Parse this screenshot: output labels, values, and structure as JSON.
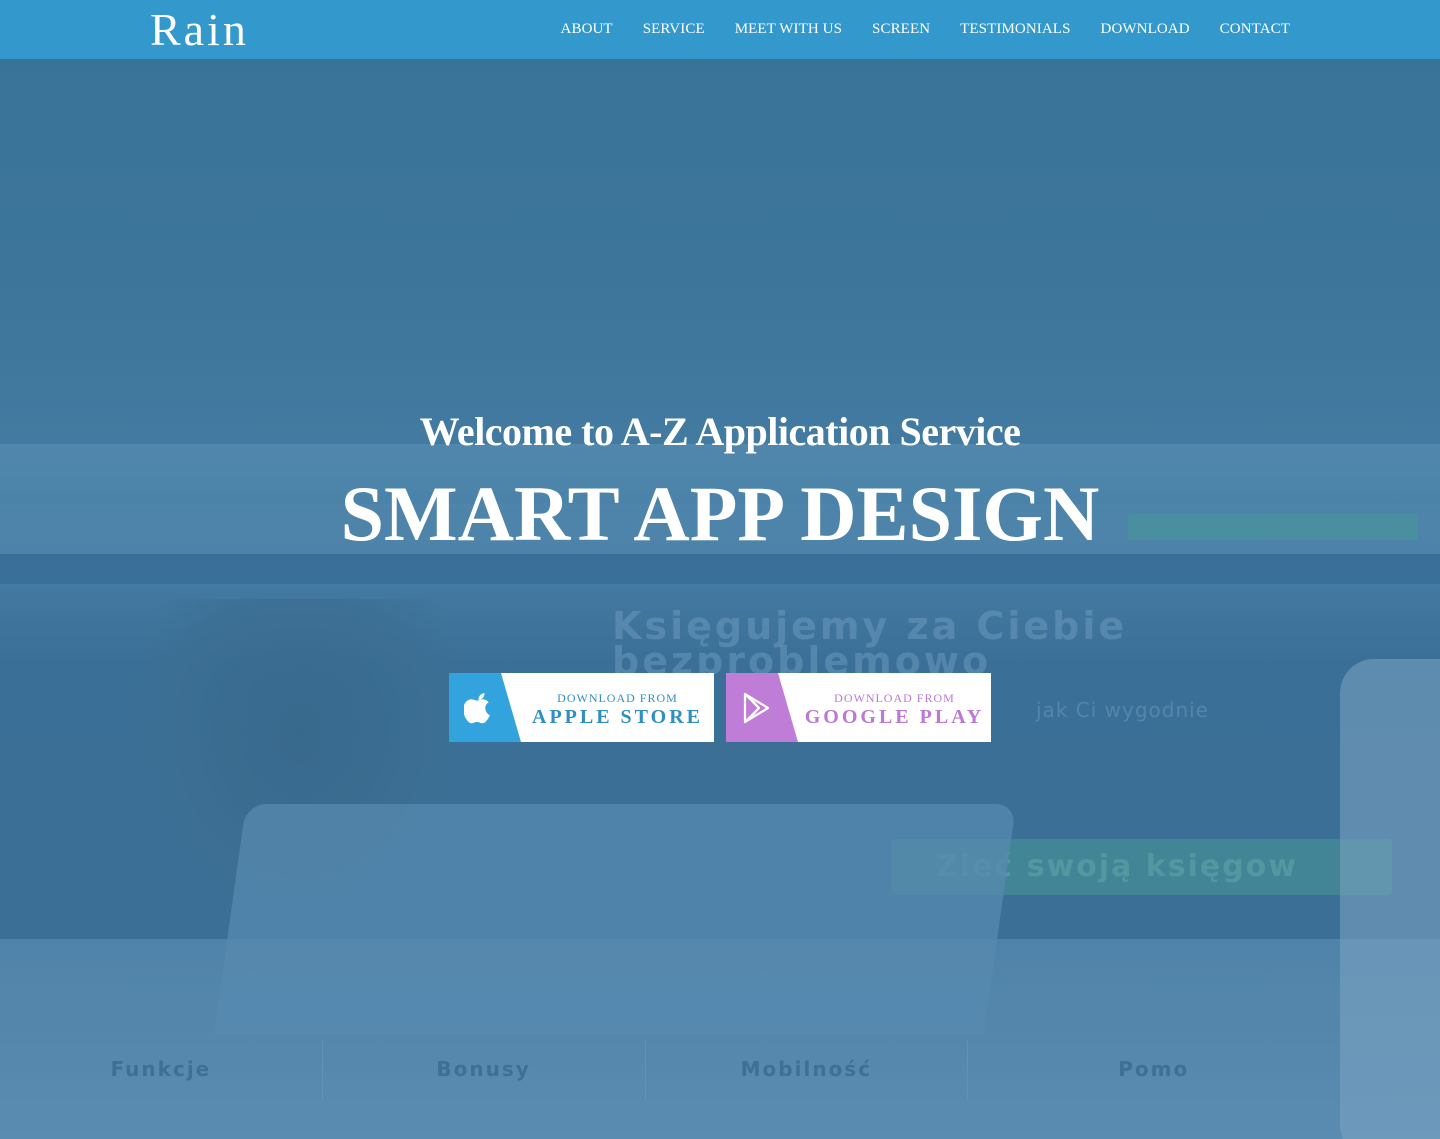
{
  "brand": {
    "logo": "Rain",
    "nav_color": "#3399cc"
  },
  "nav": {
    "items": [
      {
        "label": "ABOUT"
      },
      {
        "label": "SERVICE"
      },
      {
        "label": "MEET WITH US"
      },
      {
        "label": "SCREEN"
      },
      {
        "label": "TESTIMONIALS"
      },
      {
        "label": "DOWNLOAD"
      },
      {
        "label": "CONTACT"
      }
    ]
  },
  "hero": {
    "subtitle": "Welcome to A-Z Application Service",
    "title": "SMART APP DESIGN",
    "buttons": {
      "apple": {
        "small": "DOWNLOAD FROM",
        "big": "APPLE STORE",
        "icon": "apple-icon",
        "color": "#33a3dd"
      },
      "google": {
        "small": "DOWNLOAD FROM",
        "big": "GOOGLE PLAY",
        "icon": "google-play-icon",
        "color": "#c07dd8"
      }
    }
  },
  "background_photo": {
    "heading_line1": "Księgujemy za Ciebie",
    "heading_line2": "bezproblemowo",
    "bullets": "jak Ci wygodnie",
    "cta": "Zleć swoją księgow",
    "tabs": [
      "Funkcje",
      "Bonusy",
      "Mobilność",
      "Pomo"
    ]
  }
}
